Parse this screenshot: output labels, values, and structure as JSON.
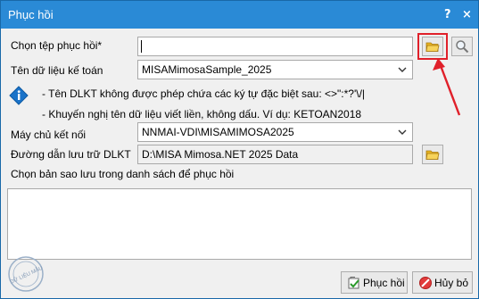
{
  "window": {
    "title": "Phục hồi",
    "help_symbol": "?",
    "close_symbol": "×"
  },
  "form": {
    "backup_file": {
      "label": "Chọn tệp phục hồi*",
      "value": "",
      "browse_icon": "folder-icon",
      "search_icon": "magnifier-icon"
    },
    "database_name": {
      "label": "Tên dữ liệu kế toán",
      "value": "MISAMimosaSample_2025"
    },
    "notes": [
      "- Tên DLKT không được phép chứa các ký tự đặc biệt sau: <>\":*?'\\/|",
      "- Khuyến nghị tên dữ liệu viết liền, không dấu. Ví dụ: KETOAN2018"
    ],
    "server": {
      "label": "Máy chủ kết nối",
      "value": "NNMAI-VDI\\MISAMIMOSA2025"
    },
    "data_path": {
      "label": "Đường dẫn lưu trữ DLKT",
      "value": "D:\\MISA Mimosa.NET 2025 Data"
    },
    "backup_list": {
      "label": "Chọn bản sao lưu trong danh sách để phục hồi"
    }
  },
  "buttons": {
    "restore_label": "Phục hồi",
    "cancel_label": "Hủy bỏ"
  },
  "watermark": {
    "text": "DỮ LIỆU MẪU"
  },
  "colors": {
    "titlebar": "#2a8ad6",
    "highlight": "#e0202a",
    "info": "#1a73c9",
    "folder": "#f4c430"
  }
}
